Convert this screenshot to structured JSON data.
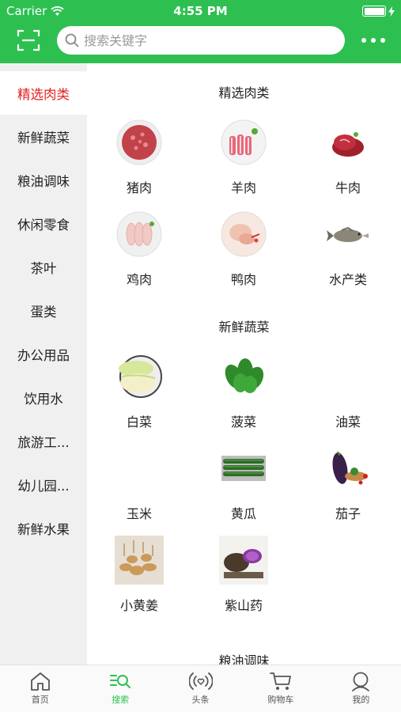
{
  "status_bar": {
    "carrier": "Carrier",
    "time": "4:55 PM"
  },
  "header": {
    "search_placeholder": "搜索关键字"
  },
  "sidebar": {
    "items": [
      {
        "label": "精选肉类",
        "active": true
      },
      {
        "label": "新鲜蔬菜"
      },
      {
        "label": "粮油调味"
      },
      {
        "label": "休闲零食"
      },
      {
        "label": "茶叶"
      },
      {
        "label": "蛋类"
      },
      {
        "label": "办公用品"
      },
      {
        "label": "饮用水"
      },
      {
        "label": "旅游工..."
      },
      {
        "label": "幼儿园..."
      },
      {
        "label": "新鲜水果"
      }
    ]
  },
  "content": {
    "sections": [
      {
        "title": "精选肉类",
        "items": [
          {
            "label": "猪肉",
            "icon": "ground-pork-image"
          },
          {
            "label": "羊肉",
            "icon": "lamb-rolls-image"
          },
          {
            "label": "牛肉",
            "icon": "beef-image"
          },
          {
            "label": "鸡肉",
            "icon": "chicken-wings-image"
          },
          {
            "label": "鸭肉",
            "icon": "duck-image"
          },
          {
            "label": "水产类",
            "icon": "fish-image"
          }
        ]
      },
      {
        "title": "新鲜蔬菜",
        "items": [
          {
            "label": "白菜",
            "icon": "cabbage-image"
          },
          {
            "label": "菠菜",
            "icon": "spinach-image"
          },
          {
            "label": "油菜",
            "icon": ""
          },
          {
            "label": "玉米",
            "icon": ""
          },
          {
            "label": "黄瓜",
            "icon": "cucumber-image"
          },
          {
            "label": "茄子",
            "icon": "eggplant-image"
          },
          {
            "label": "小黄姜",
            "icon": "ginger-image"
          },
          {
            "label": "紫山药",
            "icon": "purple-yam-image"
          }
        ]
      },
      {
        "title": "粮油调味",
        "items": []
      }
    ]
  },
  "tabbar": {
    "items": [
      {
        "label": "首页",
        "icon": "home-icon"
      },
      {
        "label": "搜索",
        "icon": "search-list-icon",
        "active": true
      },
      {
        "label": "头条",
        "icon": "broadcast-icon"
      },
      {
        "label": "购物车",
        "icon": "cart-icon"
      },
      {
        "label": "我的",
        "icon": "profile-icon"
      }
    ]
  },
  "colors": {
    "brand_green": "#2dc051",
    "active_red": "#e02020",
    "sidebar_bg": "#f0f0f0"
  }
}
